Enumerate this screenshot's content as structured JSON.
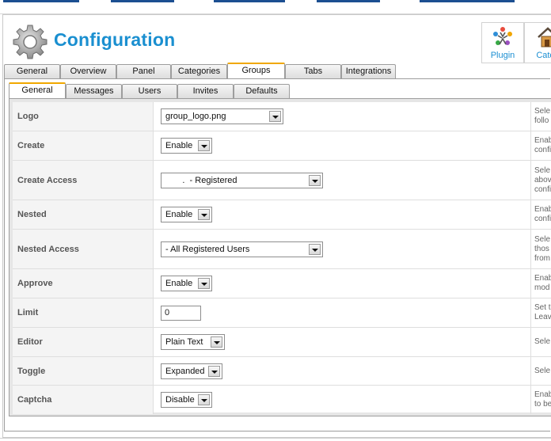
{
  "header": {
    "title": "Configuration",
    "toolbar": [
      {
        "label": "Plugin",
        "icon": "plugin-people-icon"
      },
      {
        "label": "Categ",
        "icon": "categories-house-icon"
      }
    ]
  },
  "main_tabs": [
    "General",
    "Overview",
    "Panel",
    "Categories",
    "Groups",
    "Tabs",
    "Integrations"
  ],
  "main_active": "Groups",
  "sub_tabs": [
    "General",
    "Messages",
    "Users",
    "Invites",
    "Defaults"
  ],
  "sub_active": "General",
  "rows": [
    {
      "label": "Logo",
      "control": "select",
      "value": "group_logo.png",
      "desc": [
        "Sele",
        "follo"
      ]
    },
    {
      "label": "Create",
      "control": "select",
      "value": "Enable",
      "desc": [
        "Enab",
        "confi"
      ]
    },
    {
      "label": "Create Access",
      "control": "select",
      "value": "       .  - Registered",
      "desc": [
        "Sele",
        "abov",
        "confi"
      ]
    },
    {
      "label": "Nested",
      "control": "select",
      "value": "Enable",
      "desc": [
        "Enab",
        "confi"
      ]
    },
    {
      "label": "Nested Access",
      "control": "select",
      "value": "- All Registered Users",
      "desc": [
        "Sele",
        "thos",
        "from"
      ]
    },
    {
      "label": "Approve",
      "control": "select",
      "value": "Enable",
      "desc": [
        "Enab",
        "mod"
      ]
    },
    {
      "label": "Limit",
      "control": "text",
      "value": "0",
      "desc": [
        "Set t",
        "Leav"
      ]
    },
    {
      "label": "Editor",
      "control": "select",
      "value": "Plain Text",
      "desc": [
        "Sele"
      ]
    },
    {
      "label": "Toggle",
      "control": "select",
      "value": "Expanded",
      "desc": [
        "Sele"
      ]
    },
    {
      "label": "Captcha",
      "control": "select",
      "value": "Disable",
      "desc": [
        "Enab",
        "to be"
      ]
    }
  ],
  "colors": {
    "title": "#1a8fd0",
    "active_tab_accent": "#f0a800",
    "label_bg": "#f4f4f4"
  }
}
